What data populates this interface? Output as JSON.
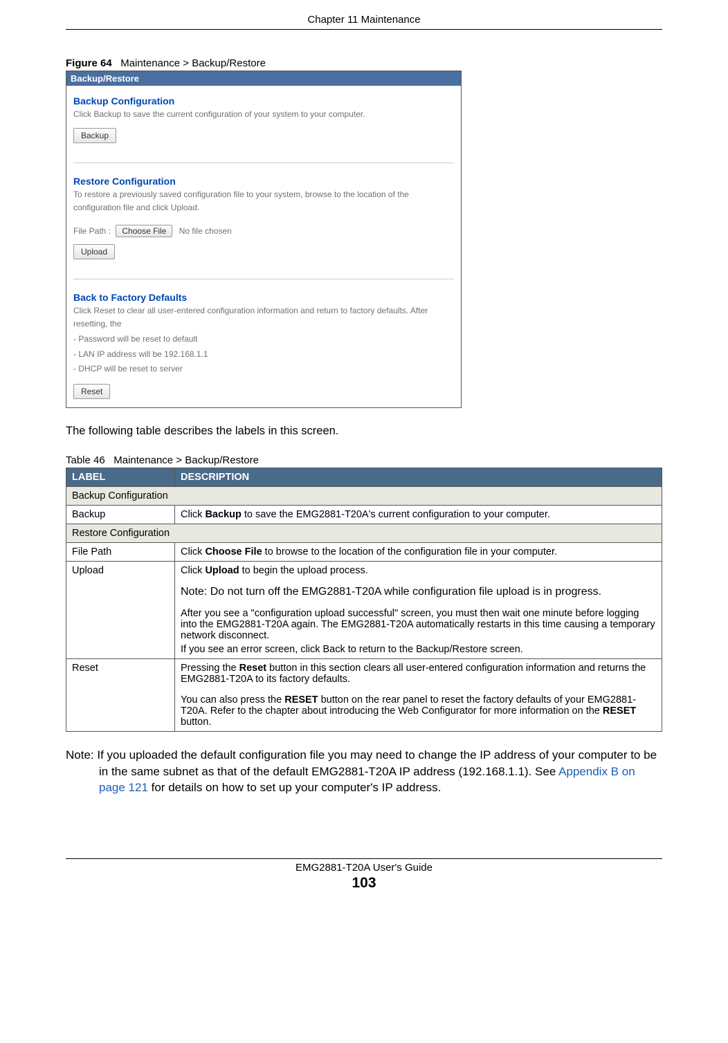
{
  "header": {
    "chapter": "Chapter 11 Maintenance"
  },
  "figure": {
    "label": "Figure 64",
    "caption": "Maintenance > Backup/Restore"
  },
  "screenshot": {
    "titlebar": "Backup/Restore",
    "backup": {
      "title": "Backup Configuration",
      "text": "Click Backup to save the current configuration of your system to your computer.",
      "button": "Backup"
    },
    "restore": {
      "title": "Restore Configuration",
      "text": "To restore a previously saved configuration file to your system, browse to the location of the configuration file and click Upload.",
      "filepath_label": "File Path :",
      "choose_btn": "Choose File",
      "nofile": "No file chosen",
      "upload_btn": "Upload"
    },
    "factory": {
      "title": "Back to Factory Defaults",
      "text": "Click Reset to clear all user-entered configuration information and return to factory defaults. After resetting, the",
      "items": [
        "- Password will be reset to default",
        "- LAN IP address will be 192.168.1.1",
        "- DHCP will be reset to server"
      ],
      "reset_btn": "Reset"
    }
  },
  "intro_text": "The following table describes the labels in this screen.",
  "table": {
    "caption_label": "Table 46",
    "caption_text": "Maintenance > Backup/Restore",
    "head_label": "LABEL",
    "head_desc": "DESCRIPTION",
    "rows": {
      "r0": "Backup Configuration",
      "r1_label": "Backup",
      "r1_desc_a": "Click ",
      "r1_desc_b": "Backup",
      "r1_desc_c": " to save the EMG2881-T20A's current configuration to your computer.",
      "r2": "Restore Configuration",
      "r3_label": "File Path",
      "r3_desc_a": "Click ",
      "r3_desc_b": "Choose File",
      "r3_desc_c": " to browse to the location of the configuration file in your computer.",
      "r4_label": "Upload",
      "r4_p1_a": "Click ",
      "r4_p1_b": "Upload",
      "r4_p1_c": " to begin the upload process.",
      "r4_p2": "Note: Do not turn off the EMG2881-T20A while configuration file upload is in progress.",
      "r4_p3": "After you see a \"configuration upload successful\" screen, you must then wait one minute before logging into the EMG2881-T20A again. The EMG2881-T20A automatically restarts in this time causing a temporary network disconnect.",
      "r4_p4": "If you see an error screen, click Back to return to the Backup/Restore screen.",
      "r5_label": "Reset",
      "r5_p1_a": "Pressing the ",
      "r5_p1_b": "Reset",
      "r5_p1_c": " button in this section clears all user-entered configuration information and returns the EMG2881-T20A to its factory defaults.",
      "r5_p2_a": "You can also press the ",
      "r5_p2_b": "RESET",
      "r5_p2_c": " button on the rear panel to reset the factory defaults of your EMG2881-T20A. Refer to the chapter about introducing the Web Configurator for more information on the ",
      "r5_p2_d": "RESET",
      "r5_p2_e": " button."
    }
  },
  "note": {
    "prefix": "Note: ",
    "text_a": "If you uploaded the default configuration file you may need to change the IP address of your computer to be in the same subnet as that of the default EMG2881-T20A IP address (192.168.1.1). See ",
    "link": "Appendix B on page 121",
    "text_b": " for details on how to set up your computer's IP address."
  },
  "footer": {
    "guide": "EMG2881-T20A User's Guide",
    "page": "103"
  }
}
